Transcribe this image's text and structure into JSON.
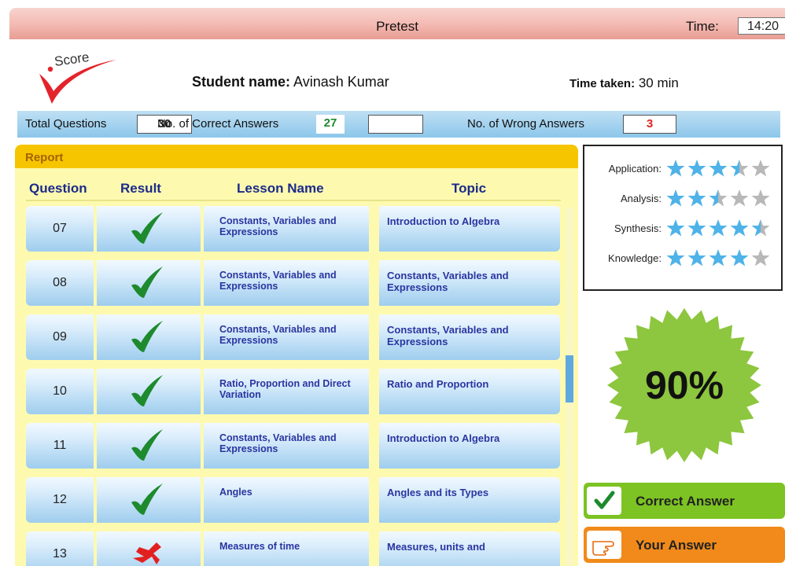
{
  "header": {
    "title": "Pretest",
    "time_label": "Time:",
    "time_value": "14:20",
    "logo_text": "Score",
    "student_label": "Student name:",
    "student_name": "Avinash Kumar",
    "time_taken_label": "Time taken:",
    "time_taken_value": "30 min"
  },
  "stats": {
    "total_label": "Total Questions",
    "total_value": "30",
    "correct_label": "No. of Correct Answers",
    "correct_value": "27",
    "wrong_label": "No. of Wrong Answers",
    "wrong_value": "3"
  },
  "report": {
    "title": "Report",
    "columns": [
      "Question",
      "Result",
      "Lesson Name",
      "Topic"
    ],
    "rows": [
      {
        "q": "07",
        "result": "correct",
        "lesson": "Constants, Variables and Expressions",
        "topic": "Introduction to Algebra"
      },
      {
        "q": "08",
        "result": "correct",
        "lesson": "Constants, Variables and Expressions",
        "topic": "Constants, Variables and Expressions"
      },
      {
        "q": "09",
        "result": "correct",
        "lesson": "Constants, Variables and Expressions",
        "topic": "Constants, Variables and Expressions"
      },
      {
        "q": "10",
        "result": "correct",
        "lesson": "Ratio, Proportion and Direct Variation",
        "topic": "Ratio and Proportion"
      },
      {
        "q": "11",
        "result": "correct",
        "lesson": "Constants, Variables and Expressions",
        "topic": "Introduction to Algebra"
      },
      {
        "q": "12",
        "result": "correct",
        "lesson": "Angles",
        "topic": "Angles and its Types"
      },
      {
        "q": "13",
        "result": "wrong",
        "lesson": "Measures of time",
        "topic": "Measures, units and"
      }
    ]
  },
  "skills": [
    {
      "label": "Application:",
      "rating": 3.5
    },
    {
      "label": "Analysis:",
      "rating": 2.5
    },
    {
      "label": "Synthesis:",
      "rating": 4.5
    },
    {
      "label": "Knowledge:",
      "rating": 4
    }
  ],
  "score": {
    "percent": "90%"
  },
  "legend": {
    "correct_label": "Correct Answer",
    "your_label": "Your Answer"
  },
  "colors": {
    "correct": "#1e8a2e",
    "wrong": "#e32020",
    "star_on": "#4fb3e8",
    "star_off": "#b8b8b8",
    "badge": "#8dc63f"
  }
}
